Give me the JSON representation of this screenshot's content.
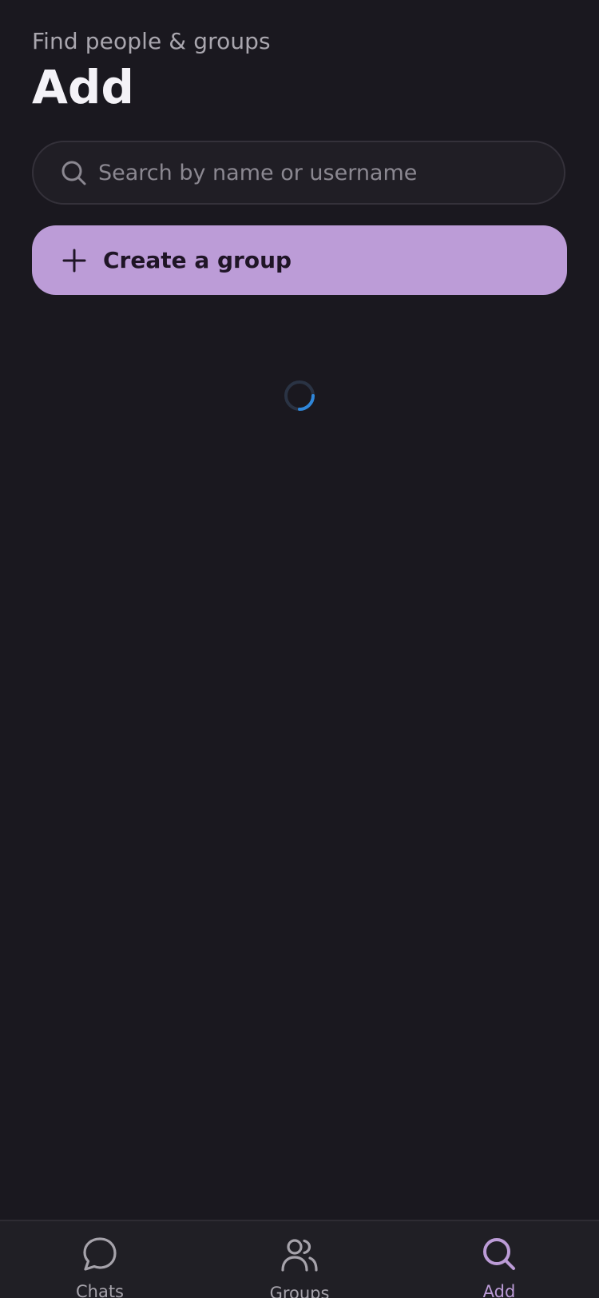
{
  "header": {
    "subtitle": "Find people & groups",
    "title": "Add"
  },
  "search": {
    "placeholder": "Search by name or username",
    "value": "",
    "icon": "search-icon"
  },
  "actions": {
    "create_group_label": "Create a group",
    "create_group_icon": "plus-icon"
  },
  "status": {
    "loading": true
  },
  "tabbar": {
    "tabs": [
      {
        "label": "Chats",
        "icon": "chat-bubble-icon",
        "active": false
      },
      {
        "label": "Groups",
        "icon": "users-icon",
        "active": false
      },
      {
        "label": "Add",
        "icon": "search-icon",
        "active": true
      }
    ]
  },
  "colors": {
    "background": "#1a181f",
    "accent": "#bc9cd7",
    "spinner": "#2f86d9",
    "inactive": "#a6a3ab"
  }
}
